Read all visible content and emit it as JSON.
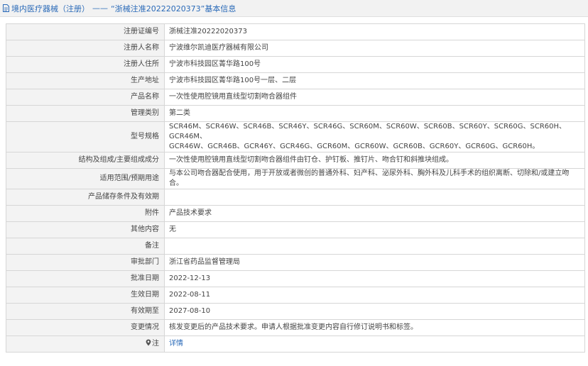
{
  "header": {
    "category": "境内医疗器械（注册）",
    "separator": "——",
    "title_suffix": "“浙械注准20222020373”基本信息"
  },
  "rows": [
    {
      "label": "注册证编号",
      "value": "浙械注准20222020373"
    },
    {
      "label": "注册人名称",
      "value": "宁波维尔凯迪医疗器械有限公司"
    },
    {
      "label": "注册人住所",
      "value": "宁波市科技园区菁华路100号"
    },
    {
      "label": "生产地址",
      "value": "宁波市科技园区菁华路100号一层、二层"
    },
    {
      "label": "产品名称",
      "value": "一次性使用腔镜用直线型切割吻合器组件"
    },
    {
      "label": "管理类别",
      "value": "第二类"
    },
    {
      "label": "型号规格",
      "value_line1": "SCR46M、SCR46W、SCR46B、SCR46Y、SCR46G、SCR60M、SCR60W、SCR60B、SCR60Y、SCR60G、SCR60H、GCR46M、",
      "value_line2": "GCR46W、GCR46B、GCR46Y、GCR46G、GCR60M、GCR60W、GCR60B、GCR60Y、GCR60G、GCR60H。"
    },
    {
      "label": "结构及组成/主要组成成分",
      "value": "一次性使用腔镜用直线型切割吻合器组件由钉仓、护钉板、推钉片、吻合钉和斜推块组成。"
    },
    {
      "label": "适用范围/预期用途",
      "value": "与本公司吻合器配合使用，用于开放或者微创的普通外科、妇产科、泌尿外科、胸外科及儿科手术的组织离断、切除和/或建立吻合。"
    },
    {
      "label": "产品储存条件及有效期",
      "value": ""
    },
    {
      "label": "附件",
      "value": "产品技术要求"
    },
    {
      "label": "其他内容",
      "value": "无"
    },
    {
      "label": "备注",
      "value": ""
    },
    {
      "label": "审批部门",
      "value": "浙江省药品监督管理局"
    },
    {
      "label": "批准日期",
      "value": "2022-12-13"
    },
    {
      "label": "生效日期",
      "value": "2022-08-11"
    },
    {
      "label": "有效期至",
      "value": "2027-08-10"
    },
    {
      "label": "变更情况",
      "value": "核发变更后的产品技术要求。申请人根据批准变更内容自行修订说明书和标签。"
    },
    {
      "label": "注",
      "value": "详情"
    }
  ],
  "icons": {
    "header": "document-icon",
    "note": "location-pin-icon"
  },
  "colors": {
    "link": "#2a6ab8",
    "label_bg": "#f3f3f3",
    "border": "#d6d6d6"
  }
}
